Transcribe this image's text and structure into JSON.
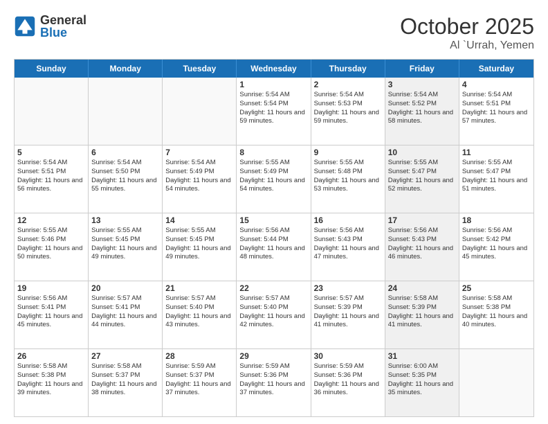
{
  "header": {
    "logo": {
      "general": "General",
      "blue": "Blue"
    },
    "title": "October 2025",
    "subtitle": "Al `Urrah, Yemen"
  },
  "calendar": {
    "weekdays": [
      "Sunday",
      "Monday",
      "Tuesday",
      "Wednesday",
      "Thursday",
      "Friday",
      "Saturday"
    ],
    "weeks": [
      [
        {
          "day": "",
          "text": "",
          "empty": true
        },
        {
          "day": "",
          "text": "",
          "empty": true
        },
        {
          "day": "",
          "text": "",
          "empty": true
        },
        {
          "day": "1",
          "text": "Sunrise: 5:54 AM\nSunset: 5:54 PM\nDaylight: 11 hours and 59 minutes.",
          "empty": false
        },
        {
          "day": "2",
          "text": "Sunrise: 5:54 AM\nSunset: 5:53 PM\nDaylight: 11 hours and 59 minutes.",
          "empty": false
        },
        {
          "day": "3",
          "text": "Sunrise: 5:54 AM\nSunset: 5:52 PM\nDaylight: 11 hours and 58 minutes.",
          "empty": false,
          "shaded": true
        },
        {
          "day": "4",
          "text": "Sunrise: 5:54 AM\nSunset: 5:51 PM\nDaylight: 11 hours and 57 minutes.",
          "empty": false
        }
      ],
      [
        {
          "day": "5",
          "text": "Sunrise: 5:54 AM\nSunset: 5:51 PM\nDaylight: 11 hours and 56 minutes.",
          "empty": false
        },
        {
          "day": "6",
          "text": "Sunrise: 5:54 AM\nSunset: 5:50 PM\nDaylight: 11 hours and 55 minutes.",
          "empty": false
        },
        {
          "day": "7",
          "text": "Sunrise: 5:54 AM\nSunset: 5:49 PM\nDaylight: 11 hours and 54 minutes.",
          "empty": false
        },
        {
          "day": "8",
          "text": "Sunrise: 5:55 AM\nSunset: 5:49 PM\nDaylight: 11 hours and 54 minutes.",
          "empty": false
        },
        {
          "day": "9",
          "text": "Sunrise: 5:55 AM\nSunset: 5:48 PM\nDaylight: 11 hours and 53 minutes.",
          "empty": false
        },
        {
          "day": "10",
          "text": "Sunrise: 5:55 AM\nSunset: 5:47 PM\nDaylight: 11 hours and 52 minutes.",
          "empty": false,
          "shaded": true
        },
        {
          "day": "11",
          "text": "Sunrise: 5:55 AM\nSunset: 5:47 PM\nDaylight: 11 hours and 51 minutes.",
          "empty": false
        }
      ],
      [
        {
          "day": "12",
          "text": "Sunrise: 5:55 AM\nSunset: 5:46 PM\nDaylight: 11 hours and 50 minutes.",
          "empty": false
        },
        {
          "day": "13",
          "text": "Sunrise: 5:55 AM\nSunset: 5:45 PM\nDaylight: 11 hours and 49 minutes.",
          "empty": false
        },
        {
          "day": "14",
          "text": "Sunrise: 5:55 AM\nSunset: 5:45 PM\nDaylight: 11 hours and 49 minutes.",
          "empty": false
        },
        {
          "day": "15",
          "text": "Sunrise: 5:56 AM\nSunset: 5:44 PM\nDaylight: 11 hours and 48 minutes.",
          "empty": false
        },
        {
          "day": "16",
          "text": "Sunrise: 5:56 AM\nSunset: 5:43 PM\nDaylight: 11 hours and 47 minutes.",
          "empty": false
        },
        {
          "day": "17",
          "text": "Sunrise: 5:56 AM\nSunset: 5:43 PM\nDaylight: 11 hours and 46 minutes.",
          "empty": false,
          "shaded": true
        },
        {
          "day": "18",
          "text": "Sunrise: 5:56 AM\nSunset: 5:42 PM\nDaylight: 11 hours and 45 minutes.",
          "empty": false
        }
      ],
      [
        {
          "day": "19",
          "text": "Sunrise: 5:56 AM\nSunset: 5:41 PM\nDaylight: 11 hours and 45 minutes.",
          "empty": false
        },
        {
          "day": "20",
          "text": "Sunrise: 5:57 AM\nSunset: 5:41 PM\nDaylight: 11 hours and 44 minutes.",
          "empty": false
        },
        {
          "day": "21",
          "text": "Sunrise: 5:57 AM\nSunset: 5:40 PM\nDaylight: 11 hours and 43 minutes.",
          "empty": false
        },
        {
          "day": "22",
          "text": "Sunrise: 5:57 AM\nSunset: 5:40 PM\nDaylight: 11 hours and 42 minutes.",
          "empty": false
        },
        {
          "day": "23",
          "text": "Sunrise: 5:57 AM\nSunset: 5:39 PM\nDaylight: 11 hours and 41 minutes.",
          "empty": false
        },
        {
          "day": "24",
          "text": "Sunrise: 5:58 AM\nSunset: 5:39 PM\nDaylight: 11 hours and 41 minutes.",
          "empty": false,
          "shaded": true
        },
        {
          "day": "25",
          "text": "Sunrise: 5:58 AM\nSunset: 5:38 PM\nDaylight: 11 hours and 40 minutes.",
          "empty": false
        }
      ],
      [
        {
          "day": "26",
          "text": "Sunrise: 5:58 AM\nSunset: 5:38 PM\nDaylight: 11 hours and 39 minutes.",
          "empty": false
        },
        {
          "day": "27",
          "text": "Sunrise: 5:58 AM\nSunset: 5:37 PM\nDaylight: 11 hours and 38 minutes.",
          "empty": false
        },
        {
          "day": "28",
          "text": "Sunrise: 5:59 AM\nSunset: 5:37 PM\nDaylight: 11 hours and 37 minutes.",
          "empty": false
        },
        {
          "day": "29",
          "text": "Sunrise: 5:59 AM\nSunset: 5:36 PM\nDaylight: 11 hours and 37 minutes.",
          "empty": false
        },
        {
          "day": "30",
          "text": "Sunrise: 5:59 AM\nSunset: 5:36 PM\nDaylight: 11 hours and 36 minutes.",
          "empty": false
        },
        {
          "day": "31",
          "text": "Sunrise: 6:00 AM\nSunset: 5:35 PM\nDaylight: 11 hours and 35 minutes.",
          "empty": false,
          "shaded": true
        },
        {
          "day": "",
          "text": "",
          "empty": true
        }
      ]
    ]
  }
}
